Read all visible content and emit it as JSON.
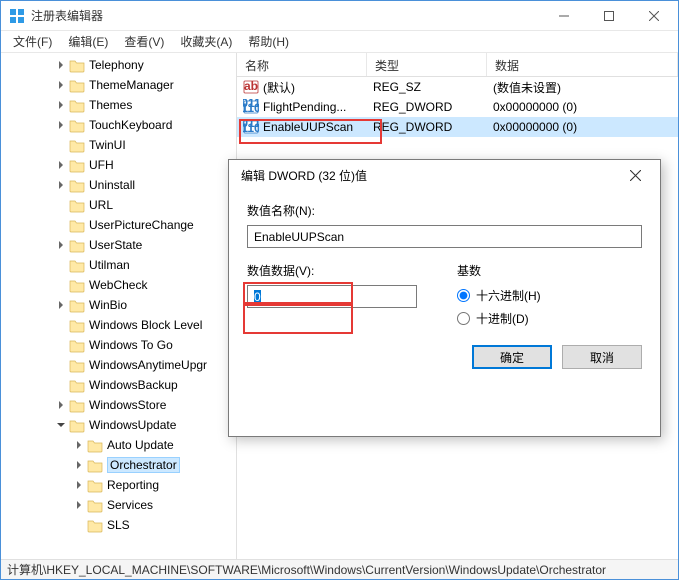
{
  "window": {
    "title": "注册表编辑器"
  },
  "menu": {
    "file": "文件(F)",
    "edit": "编辑(E)",
    "view": "查看(V)",
    "favorites": "收藏夹(A)",
    "help": "帮助(H)"
  },
  "tree": {
    "items": [
      {
        "depth": 0,
        "exp": ">",
        "label": "Telephony"
      },
      {
        "depth": 0,
        "exp": ">",
        "label": "ThemeManager"
      },
      {
        "depth": 0,
        "exp": ">",
        "label": "Themes"
      },
      {
        "depth": 0,
        "exp": ">",
        "label": "TouchKeyboard"
      },
      {
        "depth": 0,
        "exp": " ",
        "label": "TwinUI"
      },
      {
        "depth": 0,
        "exp": ">",
        "label": "UFH"
      },
      {
        "depth": 0,
        "exp": ">",
        "label": "Uninstall"
      },
      {
        "depth": 0,
        "exp": " ",
        "label": "URL"
      },
      {
        "depth": 0,
        "exp": " ",
        "label": "UserPictureChange"
      },
      {
        "depth": 0,
        "exp": ">",
        "label": "UserState"
      },
      {
        "depth": 0,
        "exp": " ",
        "label": "Utilman"
      },
      {
        "depth": 0,
        "exp": " ",
        "label": "WebCheck"
      },
      {
        "depth": 0,
        "exp": ">",
        "label": "WinBio"
      },
      {
        "depth": 0,
        "exp": " ",
        "label": "Windows Block Level"
      },
      {
        "depth": 0,
        "exp": " ",
        "label": "Windows To Go"
      },
      {
        "depth": 0,
        "exp": " ",
        "label": "WindowsAnytimeUpgr"
      },
      {
        "depth": 0,
        "exp": " ",
        "label": "WindowsBackup"
      },
      {
        "depth": 0,
        "exp": ">",
        "label": "WindowsStore"
      },
      {
        "depth": 0,
        "exp": "v",
        "label": "WindowsUpdate"
      },
      {
        "depth": 1,
        "exp": ">",
        "label": "Auto Update"
      },
      {
        "depth": 1,
        "exp": ">",
        "label": "Orchestrator",
        "selected": true
      },
      {
        "depth": 1,
        "exp": ">",
        "label": "Reporting"
      },
      {
        "depth": 1,
        "exp": ">",
        "label": "Services"
      },
      {
        "depth": 1,
        "exp": " ",
        "label": "SLS"
      }
    ]
  },
  "list": {
    "columns": {
      "name": "名称",
      "type": "类型",
      "data": "数据"
    },
    "rows": [
      {
        "icon": "string",
        "name": "(默认)",
        "type": "REG_SZ",
        "data": "(数值未设置)",
        "highlight": false
      },
      {
        "icon": "binary",
        "name": "FlightPending...",
        "type": "REG_DWORD",
        "data": "0x00000000 (0)",
        "highlight": false
      },
      {
        "icon": "binary",
        "name": "EnableUUPScan",
        "type": "REG_DWORD",
        "data": "0x00000000 (0)",
        "highlight": true
      }
    ]
  },
  "statusbar": {
    "path": "计算机\\HKEY_LOCAL_MACHINE\\SOFTWARE\\Microsoft\\Windows\\CurrentVersion\\WindowsUpdate\\Orchestrator"
  },
  "dialog": {
    "title": "编辑 DWORD (32 位)值",
    "name_label": "数值名称(N):",
    "name_value": "EnableUUPScan",
    "data_label": "数值数据(V):",
    "data_value": "0",
    "base_label": "基数",
    "radio_hex": "十六进制(H)",
    "radio_dec": "十进制(D)",
    "ok": "确定",
    "cancel": "取消"
  }
}
